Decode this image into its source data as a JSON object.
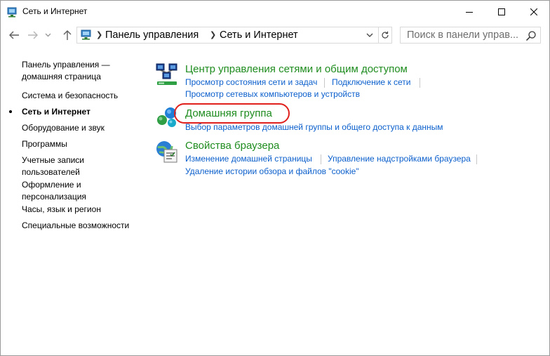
{
  "window": {
    "title": "Сеть и Интернет"
  },
  "address": {
    "breadcrumbs": [
      "Панель управления",
      "Сеть и Интернет"
    ],
    "search_placeholder": "Поиск в панели управ..."
  },
  "sidebar": {
    "items": [
      {
        "label": "Панель управления —",
        "label2": "домашняя страница"
      },
      {
        "label": "Система и безопасность"
      },
      {
        "label": "Сеть и Интернет",
        "current": true
      },
      {
        "label": "Оборудование и звук"
      },
      {
        "label": "Программы"
      },
      {
        "label": "Учетные записи",
        "label2": "пользователей"
      },
      {
        "label": "Оформление и",
        "label2": "персонализация"
      },
      {
        "label": "Часы, язык и регион"
      },
      {
        "label": "Специальные возможности"
      }
    ]
  },
  "categories": [
    {
      "title": "Центр управления сетями и общим доступом",
      "icon": "network-center-icon",
      "links": [
        "Просмотр состояния сети и задач",
        "Подключение к сети",
        "Просмотр сетевых компьютеров и устройств"
      ]
    },
    {
      "title": "Домашняя группа",
      "icon": "homegroup-icon",
      "links": [
        "Выбор параметров домашней группы и общего доступа к данным"
      ]
    },
    {
      "title": "Свойства браузера",
      "icon": "internet-options-icon",
      "links": [
        "Изменение домашней страницы",
        "Управление надстройками браузера",
        "Удаление истории обзора и файлов \"cookie\""
      ]
    }
  ],
  "colors": {
    "category_title": "#1e8c1e",
    "link": "#0b5fcc",
    "highlight": "#e0201c"
  }
}
